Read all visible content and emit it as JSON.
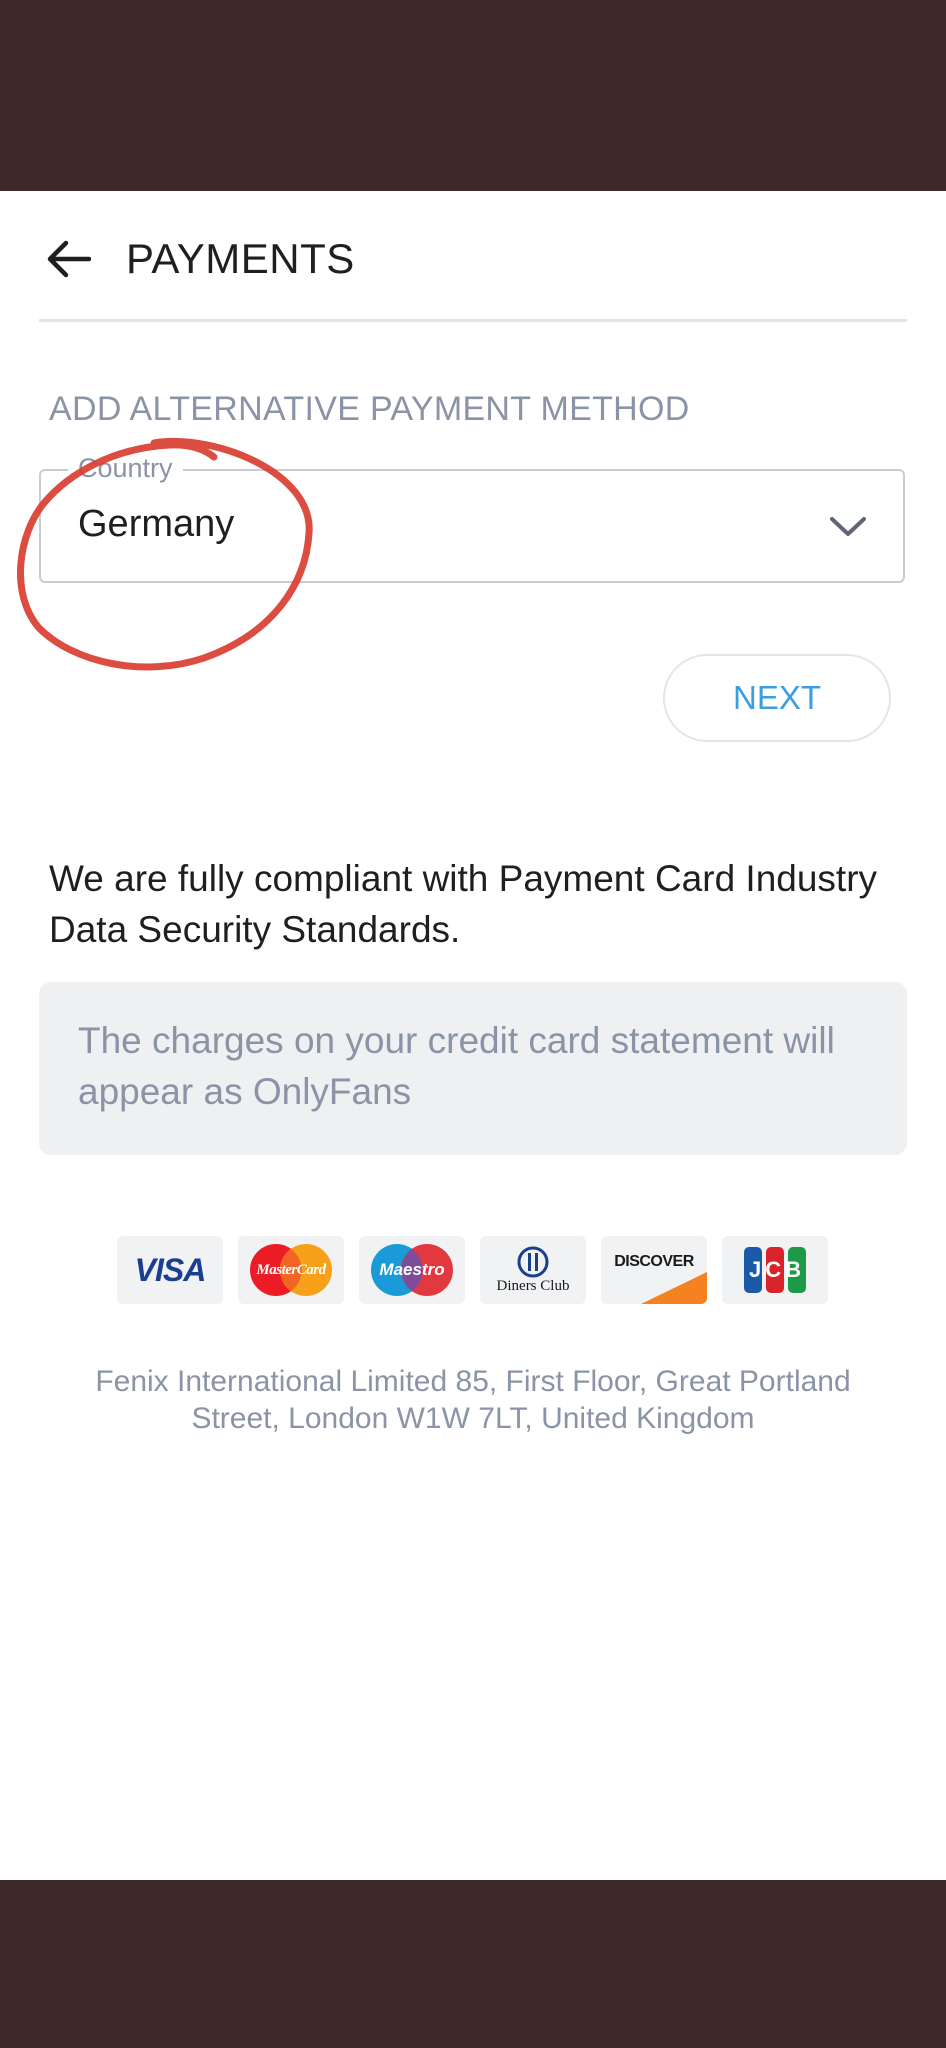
{
  "header": {
    "title": "PAYMENTS",
    "back_icon": "arrow-left-icon"
  },
  "section": {
    "title": "ADD ALTERNATIVE PAYMENT METHOD"
  },
  "country_select": {
    "label": "Country",
    "value": "Germany",
    "icon": "chevron-down-icon"
  },
  "next_button": {
    "label": "NEXT"
  },
  "compliance": {
    "text": "We are fully compliant with Payment Card Industry Data Security Standards."
  },
  "info": {
    "text": "The charges on your credit card statement will appear as OnlyFans"
  },
  "card_logos": {
    "visa": "VISA",
    "mastercard": "MasterCard",
    "maestro": "Maestro",
    "diners": "Diners Club",
    "discover": "DISCOVER",
    "jcb": "JCB"
  },
  "footer": {
    "address": "Fenix International Limited 85, First Floor, Great Portland Street, London W1W 7LT, United Kingdom"
  },
  "colors": {
    "status_bar": "#3d2828",
    "accent": "#3b9ee0",
    "muted_text": "#8a94a6",
    "annotation": "#d9392b"
  }
}
